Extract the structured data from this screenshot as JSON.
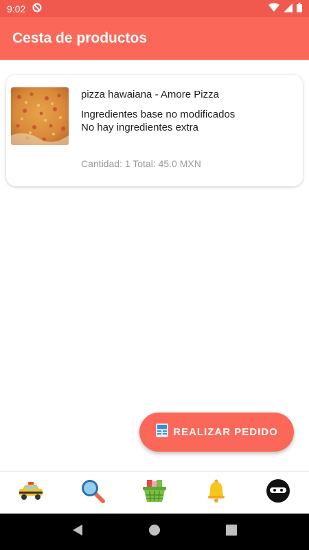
{
  "status_bar": {
    "time": "9:02"
  },
  "app_bar": {
    "title": "Cesta de productos"
  },
  "cart": {
    "items": [
      {
        "name": "pizza hawaiana - Amore Pizza",
        "ingredients_base": "Ingredientes base no modificados",
        "ingredients_extra": "No hay ingredientes extra",
        "summary": "Cantidad: 1 Total: 45.0 MXN",
        "image_icon": "pizza-photo"
      }
    ]
  },
  "fab": {
    "label": "REALIZAR PEDIDO",
    "icon": "receipt-icon"
  },
  "bottom_nav": {
    "items": [
      {
        "icon": "taxi-icon"
      },
      {
        "icon": "search-icon"
      },
      {
        "icon": "basket-icon"
      },
      {
        "icon": "bell-icon"
      },
      {
        "icon": "ninja-avatar-icon"
      }
    ]
  },
  "colors": {
    "primary": "#fb6859",
    "status_bar": "#f05a4e",
    "muted_text": "#999999"
  }
}
